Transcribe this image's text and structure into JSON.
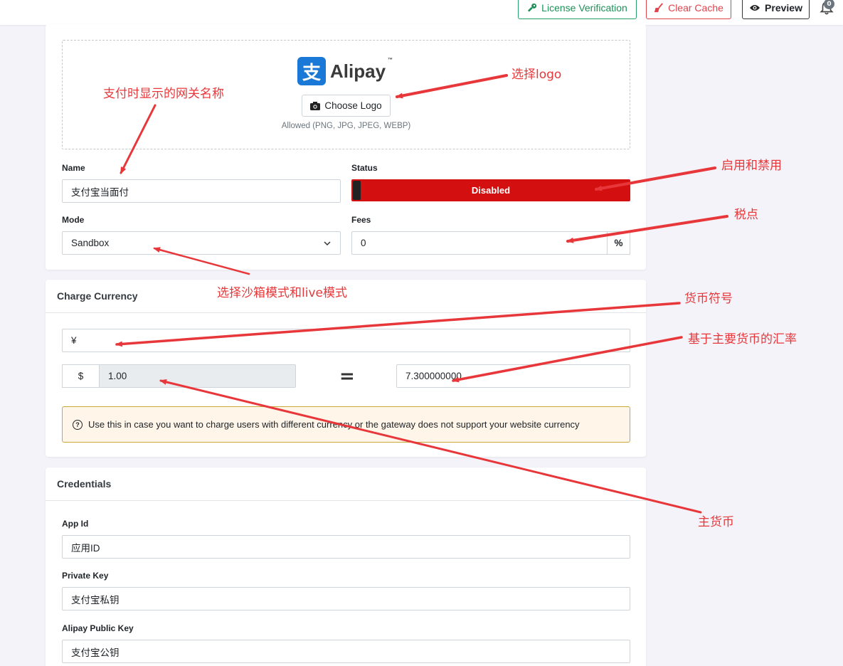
{
  "topbar": {
    "license_label": "License Verification",
    "cache_label": "Clear Cache",
    "preview_label": "Preview",
    "notification_count": "0"
  },
  "gateway": {
    "logo_text": "Alipay",
    "logo_tm": "™",
    "logo_mark": "支",
    "choose_logo_label": "Choose Logo",
    "allowed_text": "Allowed (PNG, JPG, JPEG, WEBP)",
    "name_label": "Name",
    "name_value": "支付宝当面付",
    "status_label": "Status",
    "status_value": "Disabled",
    "mode_label": "Mode",
    "mode_value": "Sandbox",
    "fees_label": "Fees",
    "fees_value": "0",
    "fees_unit": "%"
  },
  "charge_currency": {
    "title": "Charge Currency",
    "symbol_value": "¥",
    "base_symbol": "$",
    "base_value": "1.00",
    "equals": "=",
    "rate_value": "7.300000000",
    "notice": "Use this in case you want to charge users with different currency or the gateway does not support your website currency"
  },
  "credentials": {
    "title": "Credentials",
    "app_id_label": "App Id",
    "app_id_value": "应用ID",
    "private_key_label": "Private Key",
    "private_key_value": "支付宝私钥",
    "public_key_label": "Alipay Public Key",
    "public_key_value": "支付宝公钥"
  },
  "annotations": {
    "choose_logo": "选择logo",
    "gateway_name": "支付时显示的网关名称",
    "enable_disable": "启用和禁用",
    "fees": "税点",
    "mode": "选择沙箱模式和live模式",
    "currency_symbol": "货币符号",
    "exchange_rate": "基于主要货币的汇率",
    "main_currency": "主货币"
  },
  "colors": {
    "accent_green": "#28a068",
    "danger_red": "#d40f0f",
    "annotation_red": "#e8373a",
    "notice_bg": "#fff5e8"
  }
}
